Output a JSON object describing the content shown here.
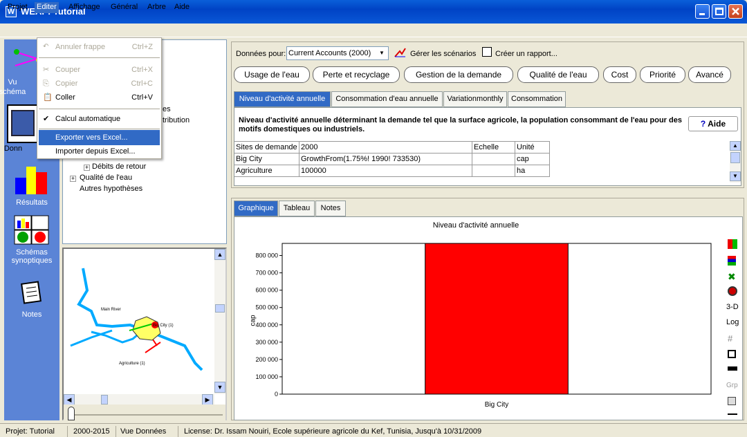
{
  "window": {
    "title": "WEAP: Tutorial",
    "icon": "W"
  },
  "menu": [
    "Projet",
    "Editer",
    "Affichage",
    "Général",
    "Arbre",
    "Aide"
  ],
  "edit_menu": {
    "undo": {
      "label": "Annuler frappe",
      "shortcut": "Ctrl+Z"
    },
    "cut": {
      "label": "Couper",
      "shortcut": "Ctrl+X"
    },
    "copy": {
      "label": "Copier",
      "shortcut": "Ctrl+C"
    },
    "paste": {
      "label": "Coller",
      "shortcut": "Ctrl+V"
    },
    "autocalc": {
      "label": "Calcul automatique"
    },
    "export": {
      "label": "Exporter vers Excel..."
    },
    "import": {
      "label": "Importer depuis Excel..."
    }
  },
  "left_bar": {
    "vue": "Vu",
    "schema": "schéma",
    "donnees": "Donn",
    "resultats": "Résultats",
    "synoptiques": "Schémas\nsynoptiques",
    "notes": "Notes"
  },
  "tree": {
    "partial1": "es",
    "partial2": "tribution",
    "debits": "Débits de retour",
    "qualite": "Qualité de l'eau",
    "autres": "Autres hypothèses"
  },
  "map": {
    "river": "Main River",
    "city": "Big City (1)",
    "agri": "Agriculture (1)"
  },
  "top": {
    "data_for_label": "Données pour:",
    "data_for_value": "Current Accounts (2000)",
    "manage": "Gérer les scénarios",
    "report": "Créer un rapport..."
  },
  "categories": [
    "Usage de l'eau",
    "Perte et recyclage",
    "Gestion de la demande",
    "Qualité de l'eau",
    "Cost",
    "Priorité",
    "Avancé"
  ],
  "tabs": [
    "Niveau d'activité annuelle",
    "Consommation d'eau annuelle",
    "Variationmonthly",
    "Consommation"
  ],
  "description": "Niveau d'activité annuelle déterminant la demande tel que la surface agricole, la population consommant de l'eau pour des motifs domestiques ou industriels.",
  "help": "Aide",
  "table": {
    "headers": [
      "Sites de demande",
      "2000",
      "Echelle",
      "Unité"
    ],
    "rows": [
      [
        "Big City",
        "GrowthFrom(1.75%! 1990! 733530)",
        "",
        "cap"
      ],
      [
        "Agriculture",
        "100000",
        "",
        "ha"
      ]
    ]
  },
  "graph_tabs": [
    "Graphique",
    "Tableau",
    "Notes"
  ],
  "graph_tools": [
    "3-D",
    "Log",
    "Grp"
  ],
  "chart_data": {
    "type": "bar",
    "title": "Niveau d'activité annuelle",
    "ylabel": "cap",
    "xlabel": "",
    "categories": [
      "Big City"
    ],
    "values": [
      870000
    ],
    "ylim": [
      0,
      870000
    ],
    "yticks": [
      "0",
      "100 000",
      "200 000",
      "300 000",
      "400 000",
      "500 000",
      "600 000",
      "700 000",
      "800 000"
    ],
    "color": "#ff0000"
  },
  "status": {
    "project": "Projet: Tutorial",
    "years": "2000-2015",
    "view": "Vue Données",
    "license": "License: Dr. Issam Nouiri, Ecole supérieure agricole du Kef, Tunisia, Jusqu'à 10/31/2009"
  }
}
